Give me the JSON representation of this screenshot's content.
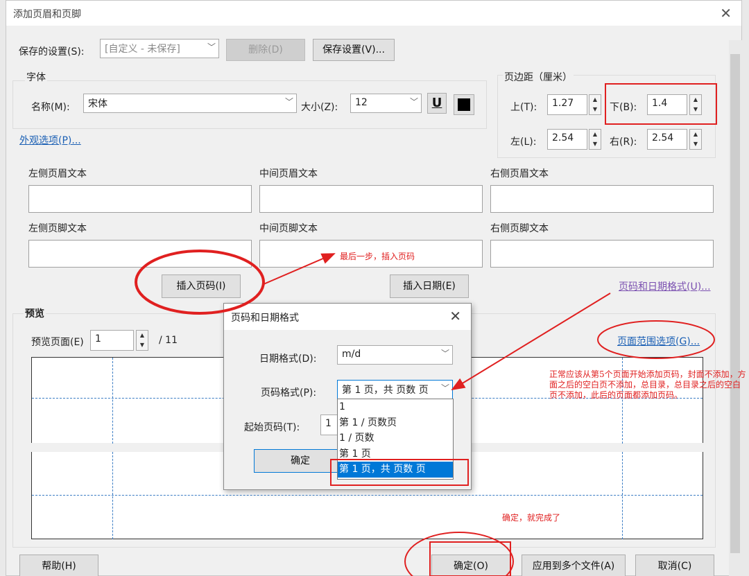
{
  "window": {
    "title": "添加页眉和页脚"
  },
  "saved_settings": {
    "label": "保存的设置(S):",
    "value": "[自定义 - 未保存]",
    "delete_label": "删除(D)",
    "save_label": "保存设置(V)..."
  },
  "font": {
    "group_label": "字体",
    "name_label": "名称(M):",
    "name_value": "宋体",
    "size_label": "大小(Z):",
    "size_value": "12",
    "underline_glyph": "U",
    "color": "#000000"
  },
  "margins": {
    "group_label": "页边距（厘米）",
    "top_label": "上(T):",
    "top_value": "1.27",
    "bottom_label": "下(B):",
    "bottom_value": "1.4",
    "left_label": "左(L):",
    "left_value": "2.54",
    "right_label": "右(R):",
    "right_value": "2.54"
  },
  "appearance_link": "外观选项(P)...",
  "header_fields": {
    "left_header": "左侧页眉文本",
    "center_header": "中间页眉文本",
    "right_header": "右侧页眉文本",
    "left_footer": "左侧页脚文本",
    "center_footer": "中间页脚文本",
    "right_footer": "右侧页脚文本"
  },
  "insert_page_number": "插入页码(I)",
  "insert_date": "插入日期(E)",
  "format_link": "页码和日期格式(U)...",
  "range_link": "页面范围选项(G)...",
  "preview": {
    "group_label": "预览",
    "page_label": "预览页面(E)",
    "page_value": "1",
    "total": "/ 11"
  },
  "footer_buttons": {
    "help": "帮助(H)",
    "ok": "确定(O)",
    "apply_multiple": "应用到多个文件(A)",
    "cancel": "取消(C)"
  },
  "subdialog": {
    "title": "页码和日期格式",
    "date_label": "日期格式(D):",
    "date_value": "m/d",
    "page_label": "页码格式(P):",
    "page_value": "第 1 页，共 页数 页",
    "start_label": "起始页码(T):",
    "start_value": "1",
    "ok": "确定",
    "options": [
      "1",
      "第 1 / 页数页",
      "1 / 页数",
      "第 1 页",
      "第 1 页，共 页数 页"
    ]
  },
  "annotations": {
    "note_last_step": "最后一步，插入页码",
    "note_normal": "正常应该从第5个页面开始添加页码，封面不添加，方面之后的空白页不添加，总目录，总目录之后的空白页不添加，此后的页面都添加页码。",
    "note_done": "确定，就完成了",
    "color": "#e02020"
  }
}
